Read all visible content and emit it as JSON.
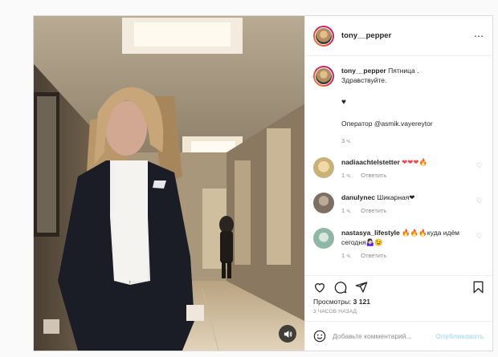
{
  "post": {
    "author": "tony__pepper",
    "more_icon": "⋯",
    "caption": {
      "username": "tony__pepper",
      "line1": "Пятница .",
      "line2": "Здравствуйте.",
      "heart": "♥",
      "operator": "Оператор @asmik.vayereytor",
      "time": "3 ч."
    },
    "comments": [
      {
        "username": "nadiaachtelstetter",
        "text": "❤❤❤🔥",
        "time": "1 ч.",
        "reply": "Ответить",
        "avatar_color": "#c8b27a"
      },
      {
        "username": "danulynec",
        "text": "Шикарная❤",
        "time": "1 ч.",
        "reply": "Ответить",
        "avatar_color": "#7d6f62"
      },
      {
        "username": "nastasya_lifestyle",
        "text": "🔥🔥🔥куда идём сегодня🤷🏻‍♀️😉",
        "time": "1 ч.",
        "reply": "Ответить",
        "avatar_color": "#8fb7a6"
      }
    ],
    "views_label": "Просмотры:",
    "views_count": "3 121",
    "time_ago": "3 часов назад",
    "comment_placeholder": "Добавьте комментарий...",
    "publish_label": "Опубликовать"
  },
  "colors": {
    "text": "#262626",
    "muted": "#8e8e8e",
    "publish_disabled": "#b2dffc",
    "heart_red": "#ed4956"
  },
  "icons": [
    "sound-icon",
    "more-icon",
    "like-icon",
    "comment-icon",
    "share-icon",
    "save-icon",
    "emoji-icon"
  ]
}
